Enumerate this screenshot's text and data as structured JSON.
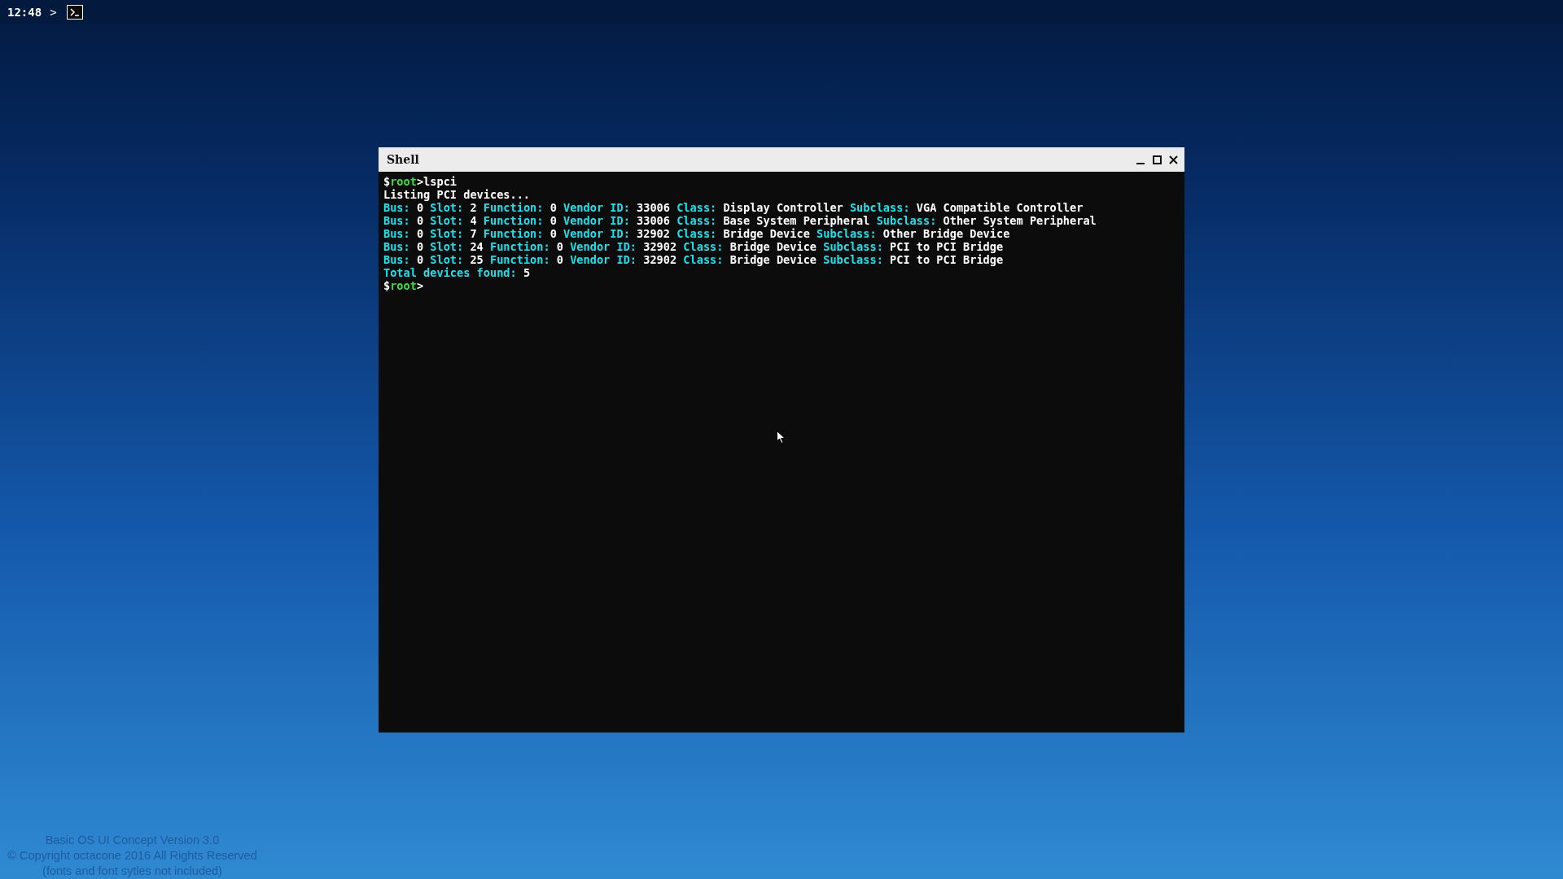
{
  "topbar": {
    "time": "12:48",
    "chevron": ">"
  },
  "window": {
    "title": "Shell",
    "lines": [
      [
        {
          "kind": "plain",
          "text": "$"
        },
        {
          "kind": "user",
          "text": "root"
        },
        {
          "kind": "plain",
          "text": ">lspci"
        }
      ],
      [
        {
          "kind": "plain",
          "text": "Listing PCI devices..."
        }
      ],
      [
        {
          "kind": "label",
          "text": "Bus: "
        },
        {
          "kind": "plain",
          "text": "0 "
        },
        {
          "kind": "label",
          "text": "Slot: "
        },
        {
          "kind": "plain",
          "text": "2 "
        },
        {
          "kind": "label",
          "text": "Function: "
        },
        {
          "kind": "plain",
          "text": "0 "
        },
        {
          "kind": "label",
          "text": "Vendor ID: "
        },
        {
          "kind": "plain",
          "text": "33006 "
        },
        {
          "kind": "label",
          "text": "Class: "
        },
        {
          "kind": "plain",
          "text": "Display Controller "
        },
        {
          "kind": "label",
          "text": "Subclass: "
        },
        {
          "kind": "plain",
          "text": "VGA Compatible Controller"
        }
      ],
      [
        {
          "kind": "label",
          "text": "Bus: "
        },
        {
          "kind": "plain",
          "text": "0 "
        },
        {
          "kind": "label",
          "text": "Slot: "
        },
        {
          "kind": "plain",
          "text": "4 "
        },
        {
          "kind": "label",
          "text": "Function: "
        },
        {
          "kind": "plain",
          "text": "0 "
        },
        {
          "kind": "label",
          "text": "Vendor ID: "
        },
        {
          "kind": "plain",
          "text": "33006 "
        },
        {
          "kind": "label",
          "text": "Class: "
        },
        {
          "kind": "plain",
          "text": "Base System Peripheral "
        },
        {
          "kind": "label",
          "text": "Subclass: "
        },
        {
          "kind": "plain",
          "text": "Other System Peripheral"
        }
      ],
      [
        {
          "kind": "label",
          "text": "Bus: "
        },
        {
          "kind": "plain",
          "text": "0 "
        },
        {
          "kind": "label",
          "text": "Slot: "
        },
        {
          "kind": "plain",
          "text": "7 "
        },
        {
          "kind": "label",
          "text": "Function: "
        },
        {
          "kind": "plain",
          "text": "0 "
        },
        {
          "kind": "label",
          "text": "Vendor ID: "
        },
        {
          "kind": "plain",
          "text": "32902 "
        },
        {
          "kind": "label",
          "text": "Class: "
        },
        {
          "kind": "plain",
          "text": "Bridge Device "
        },
        {
          "kind": "label",
          "text": "Subclass: "
        },
        {
          "kind": "plain",
          "text": "Other Bridge Device"
        }
      ],
      [
        {
          "kind": "label",
          "text": "Bus: "
        },
        {
          "kind": "plain",
          "text": "0 "
        },
        {
          "kind": "label",
          "text": "Slot: "
        },
        {
          "kind": "plain",
          "text": "24 "
        },
        {
          "kind": "label",
          "text": "Function: "
        },
        {
          "kind": "plain",
          "text": "0 "
        },
        {
          "kind": "label",
          "text": "Vendor ID: "
        },
        {
          "kind": "plain",
          "text": "32902 "
        },
        {
          "kind": "label",
          "text": "Class: "
        },
        {
          "kind": "plain",
          "text": "Bridge Device "
        },
        {
          "kind": "label",
          "text": "Subclass: "
        },
        {
          "kind": "plain",
          "text": "PCI to PCI Bridge"
        }
      ],
      [
        {
          "kind": "label",
          "text": "Bus: "
        },
        {
          "kind": "plain",
          "text": "0 "
        },
        {
          "kind": "label",
          "text": "Slot: "
        },
        {
          "kind": "plain",
          "text": "25 "
        },
        {
          "kind": "label",
          "text": "Function: "
        },
        {
          "kind": "plain",
          "text": "0 "
        },
        {
          "kind": "label",
          "text": "Vendor ID: "
        },
        {
          "kind": "plain",
          "text": "32902 "
        },
        {
          "kind": "label",
          "text": "Class: "
        },
        {
          "kind": "plain",
          "text": "Bridge Device "
        },
        {
          "kind": "label",
          "text": "Subclass: "
        },
        {
          "kind": "plain",
          "text": "PCI to PCI Bridge"
        }
      ],
      [
        {
          "kind": "label",
          "text": "Total devices found: "
        },
        {
          "kind": "plain",
          "text": "5"
        }
      ],
      [
        {
          "kind": "plain",
          "text": "$"
        },
        {
          "kind": "user",
          "text": "root"
        },
        {
          "kind": "plain",
          "text": ">"
        }
      ]
    ]
  },
  "footer": [
    "Basic OS UI Concept Version 3.0",
    "© Copyright octacone 2016 All Rights Reserved",
    "(fonts and font sytles not included)"
  ]
}
